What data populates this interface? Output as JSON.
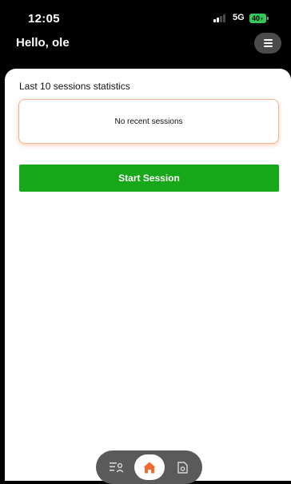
{
  "status_bar": {
    "time": "12:05",
    "network": "5G",
    "battery": "40"
  },
  "header": {
    "greeting": "Hello, ole",
    "menu_icon": "hamburger-menu-icon"
  },
  "main": {
    "section_title": "Last 10 sessions statistics",
    "empty_state": "No recent sessions",
    "start_button_label": "Start Session"
  },
  "bottom_nav": {
    "items": [
      {
        "icon": "list-user-icon",
        "active": false
      },
      {
        "icon": "home-icon",
        "active": true
      },
      {
        "icon": "document-icon",
        "active": false
      }
    ]
  },
  "colors": {
    "accent_orange": "#f26a2e",
    "start_button_green": "#17a81a",
    "card_border": "#f4b28e",
    "battery_green": "#35c759"
  }
}
